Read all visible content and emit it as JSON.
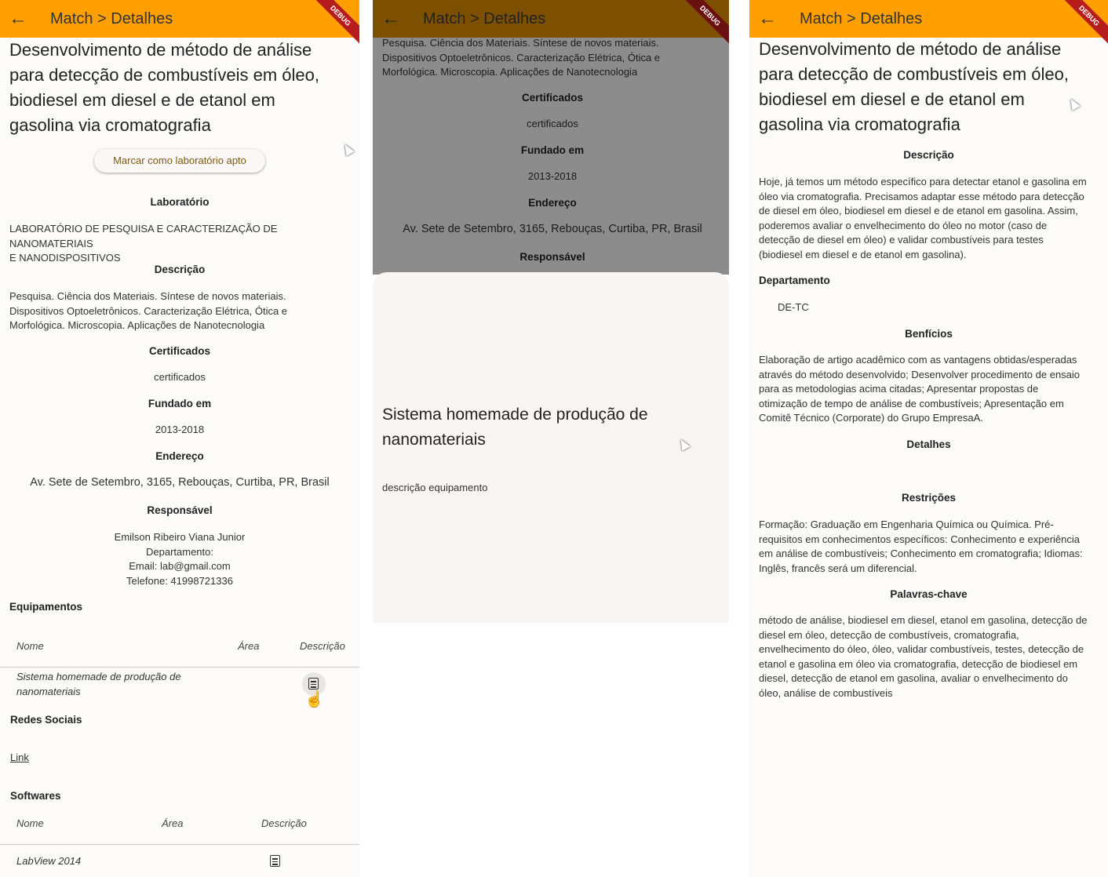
{
  "app": {
    "back_icon": "arrow-left-icon",
    "title": "Match > Detalhes",
    "debug_banner": "DEBUG",
    "appbar_color": "#ffa000"
  },
  "panel1": {
    "title_lines": [
      "Desenvolvimento de método de análise",
      "para detecção de combustíveis em óleo,",
      "biodiesel em diesel e de etanol em",
      "gasolina via cromatografia"
    ],
    "mark_button": "Marcar como laboratório apto",
    "lab_heading": "Laboratório",
    "lab_lines": [
      "LABORATÓRIO DE PESQUISA E CARACTERIZAÇÃO DE NANOMATERIAIS",
      "E NANODISPOSITIVOS"
    ],
    "desc_heading": "Descrição",
    "desc_lines": [
      "Pesquisa. Ciência dos Materiais. Síntese de novos materiais.",
      "Dispositivos Optoeletrônicos. Caracterização Elétrica, Ótica e",
      "Morfológica. Microscopia. Aplicações de Nanotecnologia"
    ],
    "cert_heading": "Certificados",
    "cert_value": "certificados",
    "founded_heading": "Fundado em",
    "founded_value": "2013-2018",
    "address_heading": "Endereço",
    "address_value": "Av. Sete de Setembro, 3165, Rebouças, Curtiba, PR, Brasil",
    "resp_heading": "Responsável",
    "resp_lines": [
      "Emilson Ribeiro Viana Junior",
      "Departamento:",
      "Email: lab@gmail.com",
      "Telefone: 41998721336"
    ],
    "equip_heading": "Equipamentos",
    "equip_cols": {
      "name": "Nome",
      "area": "Área",
      "desc": "Descrição"
    },
    "equip_rows": [
      {
        "name_lines": [
          "Sistema homemade de produção de",
          "nanomateriais"
        ],
        "icon": "description-icon"
      }
    ],
    "social_heading": "Redes Sociais",
    "social_link": "Link",
    "soft_heading": "Softwares",
    "soft_cols": {
      "name": "Nome",
      "area": "Área",
      "desc": "Descrição"
    },
    "soft_rows": [
      {
        "name": "LabView 2014",
        "icon": "description-icon"
      }
    ]
  },
  "panel2": {
    "bg_desc_lines": [
      "Pesquisa. Ciência dos Materiais. Síntese de novos materiais.",
      "Dispositivos Optoeletrônicos. Caracterização Elétrica, Ótica e",
      "Morfológica. Microscopia. Aplicações de Nanotecnologia"
    ],
    "cert_heading": "Certificados",
    "cert_value": "certificados",
    "founded_heading": "Fundado em",
    "founded_value": "2013-2018",
    "address_heading": "Endereço",
    "address_value": "Av. Sete de Setembro, 3165, Rebouças, Curtiba, PR, Brasil",
    "resp_heading": "Responsável",
    "sheet_title_lines": [
      "Sistema homemade de produção de",
      "nanomateriais"
    ],
    "sheet_desc": "descrição equipamento"
  },
  "panel3": {
    "title_lines": [
      "Desenvolvimento de método de análise",
      "para detecção de combustíveis em óleo,",
      "biodiesel em diesel e de etanol em",
      "gasolina via cromatografia"
    ],
    "desc_heading": "Descrição",
    "desc_lines": [
      "Hoje, já temos um método específico para detectar etanol e gasolina em",
      "óleo via cromatografia. Precisamos adaptar esse método para detecção",
      "de diesel em óleo, biodiesel em diesel e de etanol em gasolina. Assim,",
      "poderemos avaliar o envelhecimento do óleo no motor (caso de",
      "detecção de diesel em óleo) e validar combustíveis para testes",
      "(biodiesel em diesel e de etanol em gasolina)."
    ],
    "dept_heading": "Departamento",
    "dept_value": "DE-TC",
    "benefits_heading": "Benfícios",
    "benefits_lines": [
      "Elaboração de artigo acadêmico com as vantagens obtidas/esperadas",
      "através do método desenvolvido; Desenvolver procedimento de ensaio",
      "para as metodologias acima citadas; Apresentar propostas de",
      "otimização de tempo de análise de combustíveis; Apresentação em",
      "Comitê Técnico (Corporate) do Grupo EmpresaA."
    ],
    "details_heading": "Detalhes",
    "restrictions_heading": "Restrições",
    "restrictions_lines": [
      "Formação: Graduação em Engenharia Química ou Química. Pré-",
      "requisitos em conhecimentos específicos: Conhecimento e experiência",
      "em análise de combustíveis; Conhecimento em cromatografia; Idiomas:",
      "Inglês, francês será um diferencial."
    ],
    "keywords_heading": "Palavras-chave",
    "keywords_lines": [
      "método de análise, biodiesel em diesel, etanol em gasolina, detecção de",
      "diesel em óleo, detecção de combustíveis, cromatografia,",
      "envelhecimento do óleo, óleo, validar combustíveis, testes, detecção de",
      "etanol e gasolina em óleo via cromatografia, detecção de biodiesel em",
      "diesel, detecção de etanol em gasolina, avaliar o envelhecimento do",
      "óleo, análise de combustíveis"
    ]
  }
}
